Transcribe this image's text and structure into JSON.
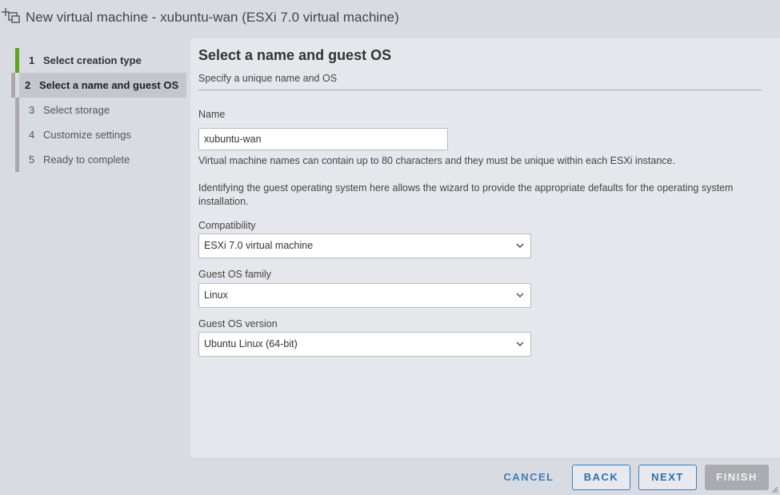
{
  "window": {
    "title": "New virtual machine - xubuntu-wan (ESXi 7.0 virtual machine)",
    "icon": "new-vm-icon"
  },
  "sidebar": {
    "steps": [
      {
        "num": "1",
        "label": "Select creation type",
        "state": "done"
      },
      {
        "num": "2",
        "label": "Select a name and guest OS",
        "state": "active"
      },
      {
        "num": "3",
        "label": "Select storage",
        "state": "pending"
      },
      {
        "num": "4",
        "label": "Customize settings",
        "state": "pending"
      },
      {
        "num": "5",
        "label": "Ready to complete",
        "state": "pending"
      }
    ]
  },
  "main": {
    "title": "Select a name and guest OS",
    "subtitle": "Specify a unique name and OS",
    "name": {
      "label": "Name",
      "value": "xubuntu-wan"
    },
    "name_help": "Virtual machine names can contain up to 80 characters and they must be unique within each ESXi instance.",
    "os_help": "Identifying the guest operating system here allows the wizard to provide the appropriate defaults for the operating system installation.",
    "compatibility": {
      "label": "Compatibility",
      "value": "ESXi 7.0 virtual machine"
    },
    "guest_os_family": {
      "label": "Guest OS family",
      "value": "Linux"
    },
    "guest_os_version": {
      "label": "Guest OS version",
      "value": "Ubuntu Linux (64-bit)"
    }
  },
  "footer": {
    "cancel_label": "CANCEL",
    "back_label": "BACK",
    "next_label": "NEXT",
    "finish_label": "FINISH"
  },
  "colors": {
    "accent": "#3e7eb6",
    "done_step": "#62a420",
    "disabled": "#a9abb0"
  }
}
